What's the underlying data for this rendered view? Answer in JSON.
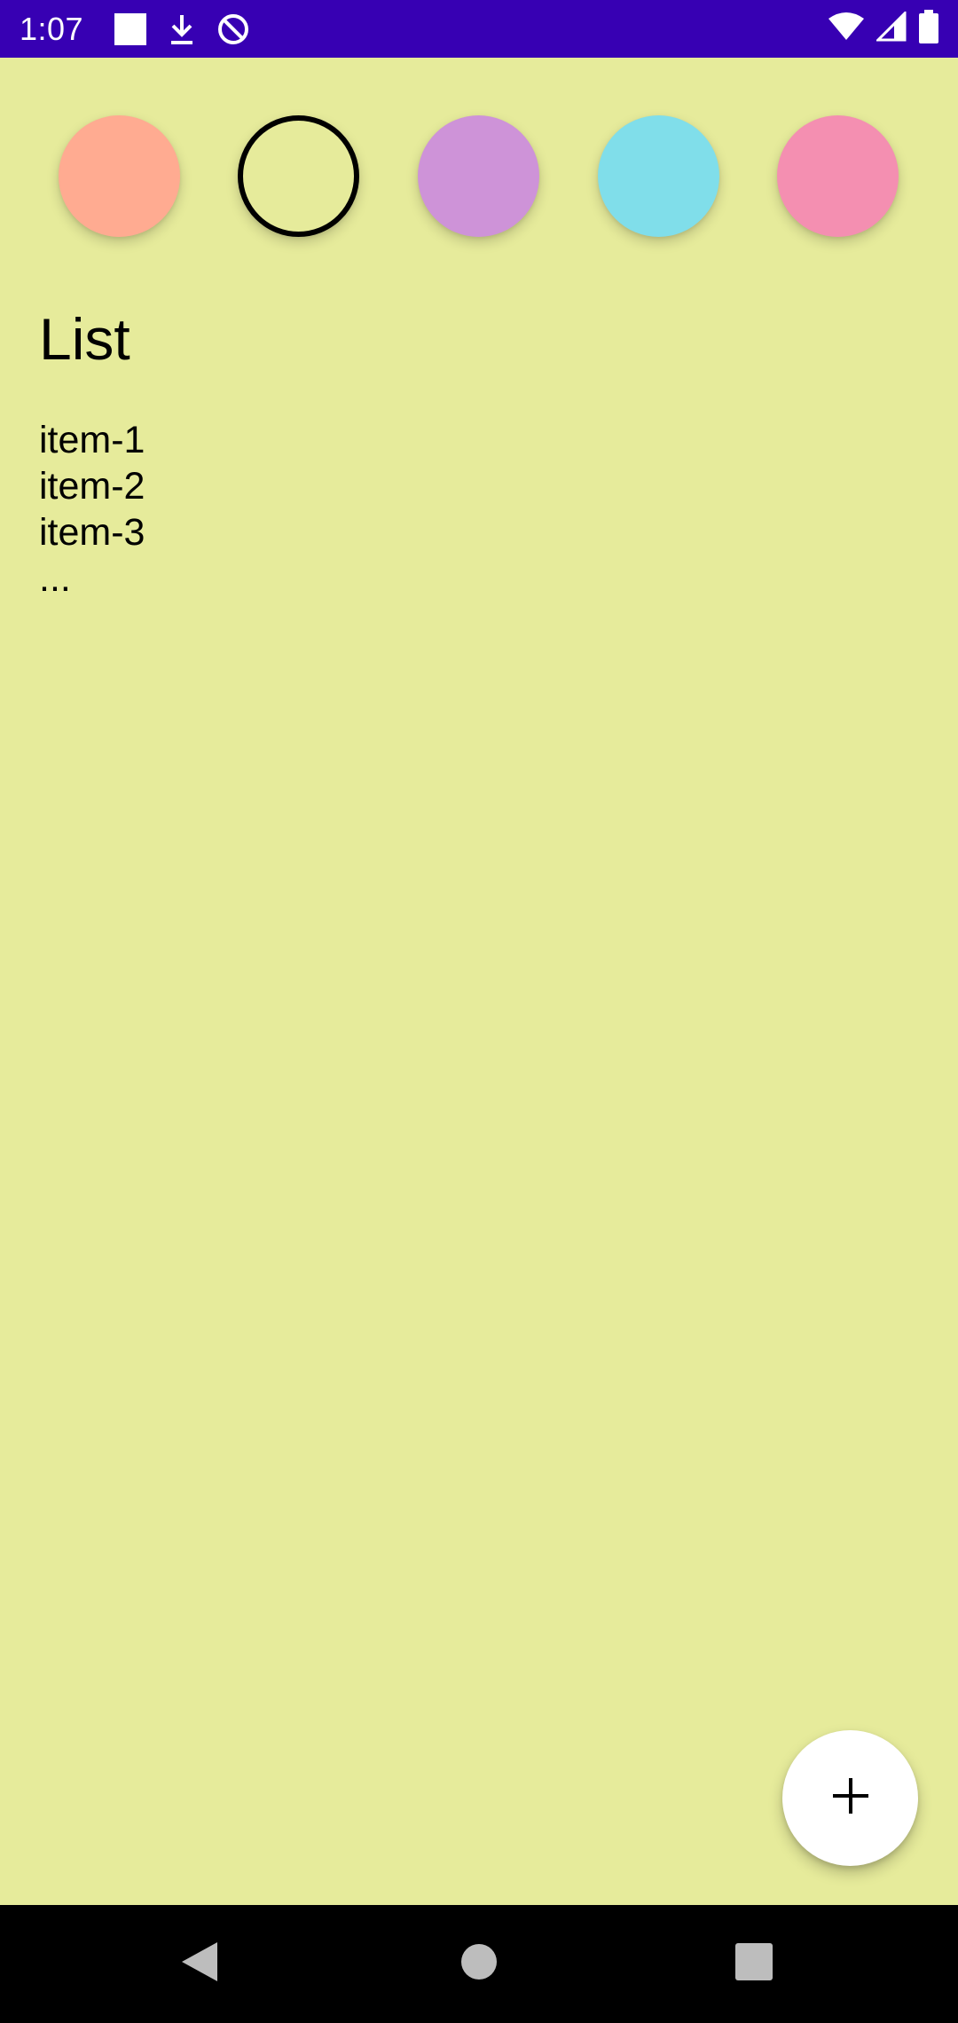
{
  "status_bar": {
    "time": "1:07",
    "background": "#3700b3",
    "left_icons": [
      "notification-square-icon",
      "download-icon",
      "sync-icon"
    ],
    "right_icons": [
      "wifi-icon",
      "cell-signal-icon",
      "battery-icon"
    ]
  },
  "palette": {
    "swatches": [
      {
        "name": "orange",
        "color": "#ffab91",
        "selected": false
      },
      {
        "name": "lime",
        "color": "#e6eb9b",
        "selected": true
      },
      {
        "name": "purple",
        "color": "#ce93d8",
        "selected": false
      },
      {
        "name": "cyan",
        "color": "#80deea",
        "selected": false
      },
      {
        "name": "pink",
        "color": "#f48fb1",
        "selected": false
      }
    ]
  },
  "note": {
    "title": "List",
    "lines": [
      "item-1",
      "item-2",
      "item-3",
      "..."
    ]
  },
  "fab": {
    "icon": "plus-icon",
    "label": "+"
  },
  "nav_bar": {
    "buttons": [
      "back-icon",
      "home-icon",
      "recents-icon"
    ]
  },
  "colors": {
    "background": "#e6eb9b",
    "fab": "#ffffff",
    "nav": "#000000"
  }
}
